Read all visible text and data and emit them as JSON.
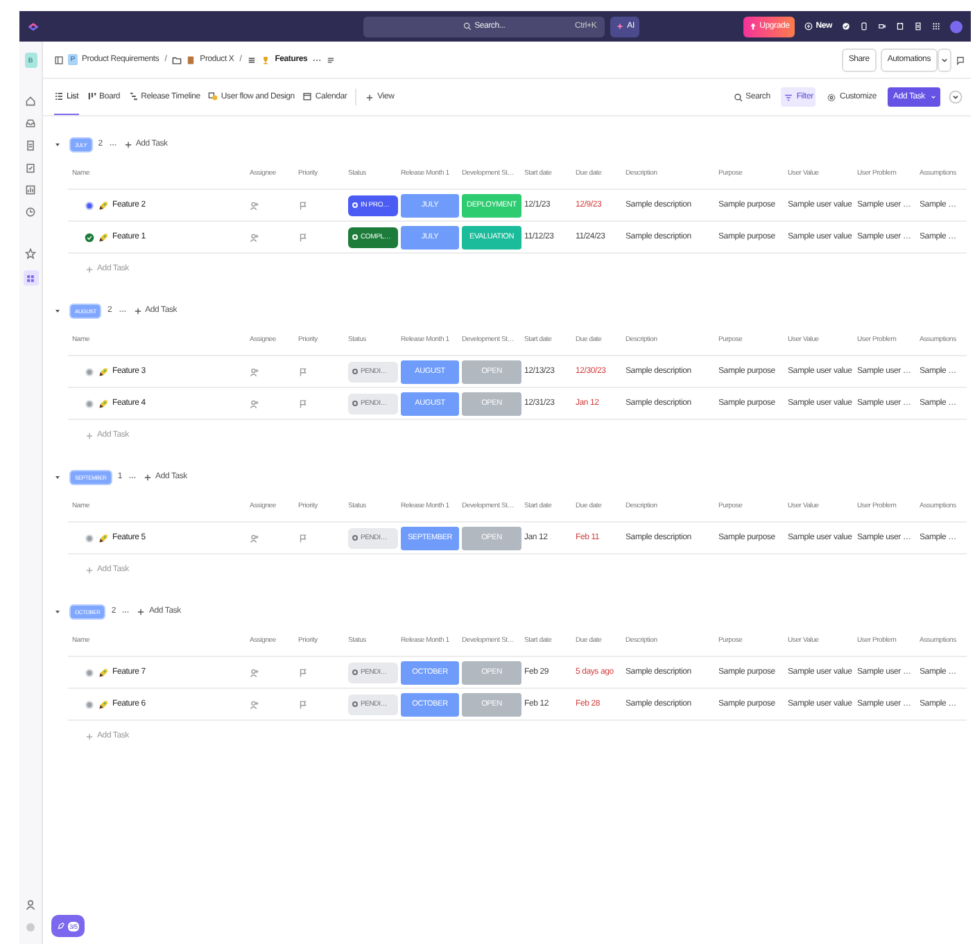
{
  "topbar": {
    "search_placeholder": "Search...",
    "shortcut": "Ctrl+K",
    "ai_label": "AI",
    "upgrade_label": "Upgrade",
    "new_label": "New"
  },
  "breadcrumb": [
    {
      "label": "Product Requirements",
      "initial": "P",
      "current": false
    },
    {
      "label": "Product X",
      "sep": "/",
      "current": false
    },
    {
      "label": "Features",
      "sep": "/",
      "current": true
    }
  ],
  "header_buttons": [
    "Share",
    "Automations"
  ],
  "views": [
    {
      "label": "List",
      "selected": true
    },
    {
      "label": "Board",
      "selected": false
    },
    {
      "label": "Release Timeline",
      "selected": false
    },
    {
      "label": "User flow and Design",
      "selected": false
    },
    {
      "label": "Calendar",
      "selected": false
    }
  ],
  "add_view_label": "View",
  "toolbar": [
    {
      "label": "Search",
      "active": false
    },
    {
      "label": "Filter",
      "active": true
    },
    {
      "label": "Customize",
      "active": false
    }
  ],
  "add_task_button": "Add Task",
  "groups": [
    {
      "label": "JULY",
      "count": "2",
      "add_label": "Add Task",
      "footer_add": "Add Task",
      "columns": [
        "Name",
        "Assignee",
        "Priority",
        "Status",
        "Release Month 1",
        "Development St…",
        "Start date",
        "Due date",
        "Description",
        "Purpose",
        "User Value",
        "User Problem",
        "Assumptions"
      ],
      "rows": [
        {
          "name": "Feature 2",
          "status": {
            "kind": "in_progress",
            "label": "IN PRO…"
          },
          "release": "JULY",
          "stage": {
            "label": "DEPLOYMENT",
            "color": "#2ecc71"
          },
          "start": "12/1/23",
          "due": "12/9/23",
          "overdue": true,
          "description": "Sample description",
          "purpose": "Sample purpose",
          "user_value": "Sample user value",
          "user_problem": "Sample user …",
          "assumptions": "Sample …"
        },
        {
          "name": "Feature 1",
          "status": {
            "kind": "complete",
            "label": "COMPL…"
          },
          "release": "JULY",
          "stage": {
            "label": "EVALUATION",
            "color": "#1bbc9b"
          },
          "start": "11/12/23",
          "due": "11/24/23",
          "overdue": false,
          "description": "Sample description",
          "purpose": "Sample purpose",
          "user_value": "Sample user value",
          "user_problem": "Sample user …",
          "assumptions": "Sample …"
        }
      ]
    },
    {
      "label": "AUGUST",
      "count": "2",
      "add_label": "Add Task",
      "footer_add": "Add Task",
      "columns": [
        "Name",
        "Assignee",
        "Priority",
        "Status",
        "Release Month 1",
        "Development St…",
        "Start date",
        "Due date",
        "Description",
        "Purpose",
        "User Value",
        "User Problem",
        "Assumptions"
      ],
      "rows": [
        {
          "name": "Feature 3",
          "status": {
            "kind": "pending",
            "label": "PENDI…"
          },
          "release": "AUGUST",
          "stage": {
            "label": "OPEN",
            "color": "#b1b8c0"
          },
          "start": "12/13/23",
          "due": "12/30/23",
          "overdue": true,
          "description": "Sample description",
          "purpose": "Sample purpose",
          "user_value": "Sample user value",
          "user_problem": "Sample user …",
          "assumptions": "Sample …"
        },
        {
          "name": "Feature 4",
          "status": {
            "kind": "pending",
            "label": "PENDI…"
          },
          "release": "AUGUST",
          "stage": {
            "label": "OPEN",
            "color": "#b1b8c0"
          },
          "start": "12/31/23",
          "due": "Jan 12",
          "overdue": true,
          "description": "Sample description",
          "purpose": "Sample purpose",
          "user_value": "Sample user value",
          "user_problem": "Sample user …",
          "assumptions": "Sample …"
        }
      ]
    },
    {
      "label": "SEPTEMBER",
      "count": "1",
      "add_label": "Add Task",
      "footer_add": "Add Task",
      "columns": [
        "Name",
        "Assignee",
        "Priority",
        "Status",
        "Release Month 1",
        "Development St…",
        "Start date",
        "Due date",
        "Description",
        "Purpose",
        "User Value",
        "User Problem",
        "Assumptions"
      ],
      "rows": [
        {
          "name": "Feature 5",
          "status": {
            "kind": "pending",
            "label": "PENDI…"
          },
          "release": "SEPTEMBER",
          "stage": {
            "label": "OPEN",
            "color": "#b1b8c0"
          },
          "start": "Jan 12",
          "due": "Feb 11",
          "overdue": true,
          "description": "Sample description",
          "purpose": "Sample purpose",
          "user_value": "Sample user value",
          "user_problem": "Sample user …",
          "assumptions": "Sample …"
        }
      ]
    },
    {
      "label": "OCTOBER",
      "count": "2",
      "add_label": "Add Task",
      "footer_add": "Add Task",
      "columns": [
        "Name",
        "Assignee",
        "Priority",
        "Status",
        "Release Month 1",
        "Development St…",
        "Start date",
        "Due date",
        "Description",
        "Purpose",
        "User Value",
        "User Problem",
        "Assumptions"
      ],
      "rows": [
        {
          "name": "Feature 7",
          "status": {
            "kind": "pending",
            "label": "PENDI…"
          },
          "release": "OCTOBER",
          "stage": {
            "label": "OPEN",
            "color": "#b1b8c0"
          },
          "start": "Feb 29",
          "due": "5 days ago",
          "overdue": true,
          "description": "Sample description",
          "purpose": "Sample purpose",
          "user_value": "Sample user value",
          "user_problem": "Sample user …",
          "assumptions": "Sample …"
        },
        {
          "name": "Feature 6",
          "status": {
            "kind": "pending",
            "label": "PENDI…"
          },
          "release": "OCTOBER",
          "stage": {
            "label": "OPEN",
            "color": "#b1b8c0"
          },
          "start": "Feb 12",
          "due": "Feb 28",
          "overdue": true,
          "description": "Sample description",
          "purpose": "Sample purpose",
          "user_value": "Sample user value",
          "user_problem": "Sample user …",
          "assumptions": "Sample …"
        }
      ]
    }
  ],
  "sidebar": {
    "workspace_initial": "B"
  },
  "checklist_badge": "3/5"
}
